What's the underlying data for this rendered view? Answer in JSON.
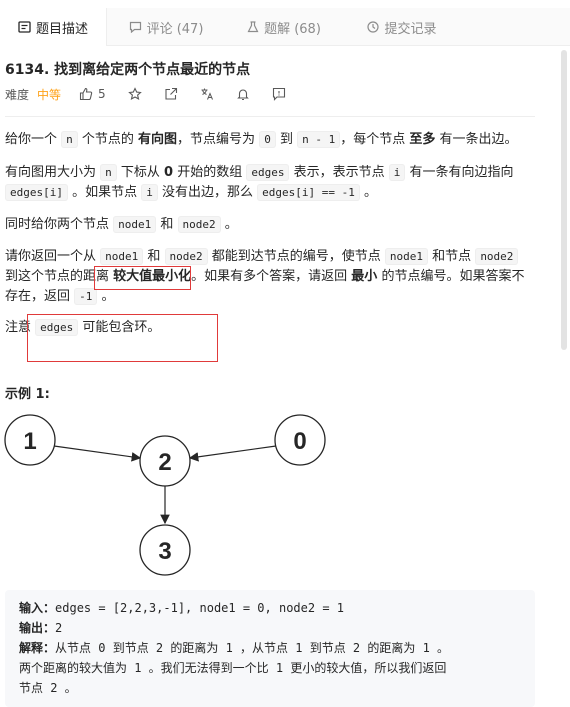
{
  "tabs": [
    {
      "label": "题目描述",
      "icon": "document-icon"
    },
    {
      "label": "评论 (47)",
      "icon": "comment-icon"
    },
    {
      "label": "题解 (68)",
      "icon": "flask-icon"
    },
    {
      "label": "提交记录",
      "icon": "clock-icon"
    }
  ],
  "problem": {
    "title": "6134. 找到离给定两个节点最近的节点",
    "difficulty_label": "难度",
    "difficulty": "中等",
    "likes": "5"
  },
  "description": {
    "p1": {
      "a": "给你一个 ",
      "code1": "n",
      "b": " 个节点的 ",
      "bold1": "有向图",
      "c": "，节点编号为 ",
      "code2": "0",
      "d": " 到 ",
      "code3": "n - 1",
      "e": "，每个节点 ",
      "bold2": "至多",
      "f": " 有一条出边。"
    },
    "p2": {
      "a": "有向图用大小为 ",
      "code1": "n",
      "b": " 下标从 ",
      "bold1": "0",
      "c": " 开始的数组 ",
      "code2": "edges",
      "d": " 表示，表示节点 ",
      "code3": "i",
      "e": " 有一条有向边指向 ",
      "code4": "edges[i]",
      "f": " 。如果节点 ",
      "code5": "i",
      "g": " 没有出边，那么 ",
      "code6": "edges[i] == -1",
      "h": " 。"
    },
    "p3": {
      "a": "同时给你两个节点 ",
      "code1": "node1",
      "b": " 和 ",
      "code2": "node2",
      "c": " 。"
    },
    "p4": {
      "a": "请你返回一个从 ",
      "code1": "node1",
      "b": " 和 ",
      "code2": "node2",
      "c": " 都能到达节点的编号，使节点 ",
      "code3": "node1",
      "d": " 和节点 ",
      "code4": "node2",
      "e": " 到这个节点的距离 ",
      "bold1": "较大值最小化",
      "f": "。如果有多个答案，请返回 ",
      "bold2": "最小",
      "g": " 的节点编号。如果答案不存在，返回 ",
      "code5": "-1",
      "h": " 。"
    },
    "p5": {
      "a": "注意 ",
      "code1": "edges",
      "b": " 可能包含环。"
    }
  },
  "example": {
    "title": "示例 1:",
    "nodes": [
      "1",
      "2",
      "0",
      "3"
    ],
    "input_label": "输入：",
    "input_value": "edges = [2,2,3,-1], node1 = 0, node2 = 1",
    "output_label": "输出：",
    "output_value": "2",
    "explain_label": "解释：",
    "explain_line1": "从节点 0 到节点 2 的距离为 1 ，从节点 1 到节点 2 的距离为 1 。",
    "explain_line2": "两个距离的较大值为 1 。我们无法得到一个比 1 更小的较大值，所以我们返回",
    "explain_line3": "节点 2 。"
  },
  "colors": {
    "accent": "#ffa116",
    "highlight_box": "#e03a3a"
  }
}
